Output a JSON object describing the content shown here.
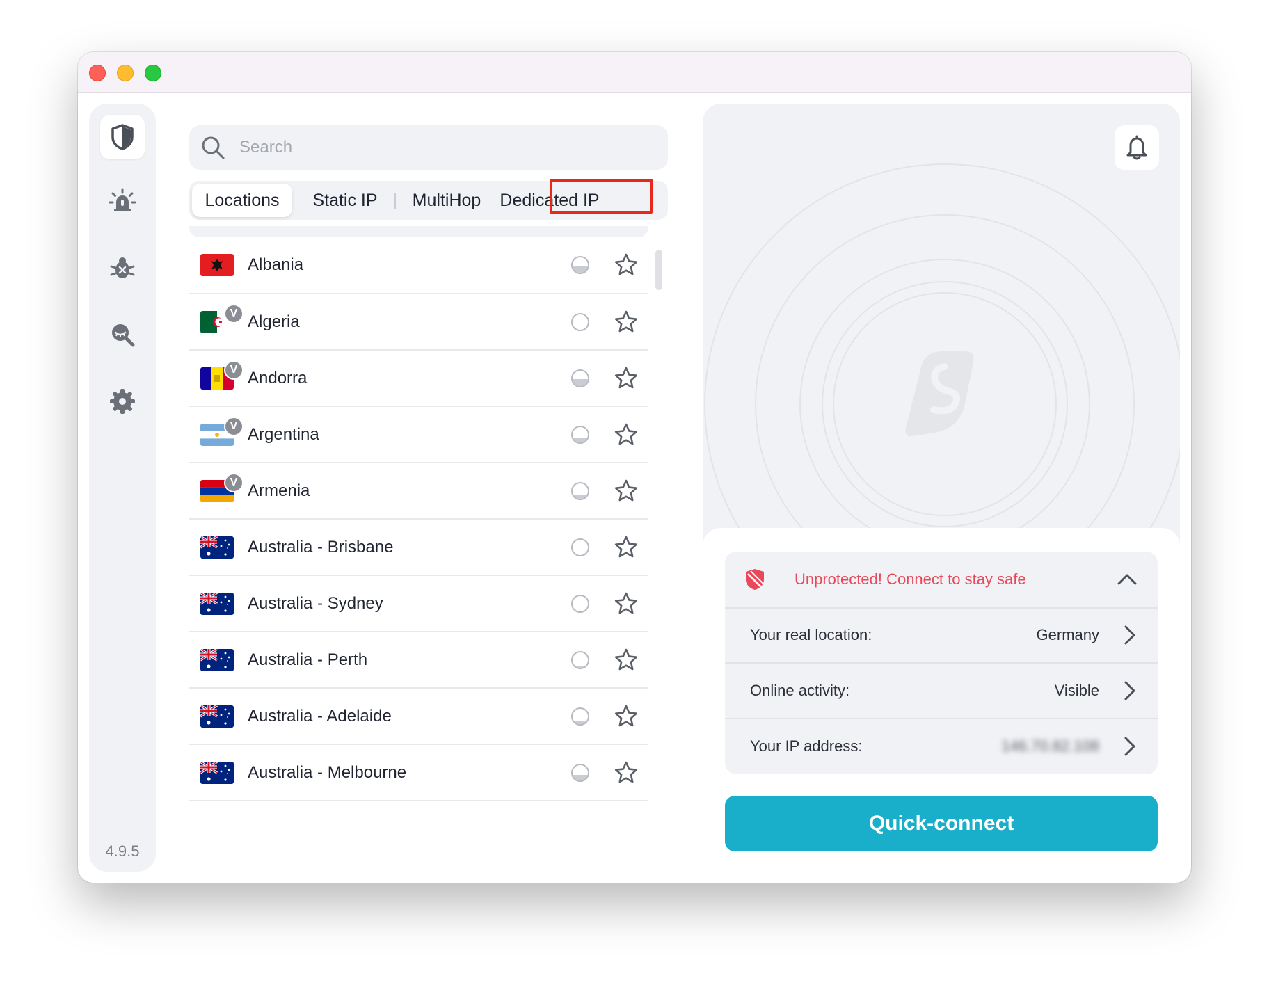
{
  "window": {
    "controls": [
      "close",
      "minimize",
      "zoom"
    ]
  },
  "sidebar": {
    "items": [
      {
        "name": "vpn",
        "icon": "shield-icon",
        "active": true
      },
      {
        "name": "alert",
        "icon": "alarm-light-icon",
        "active": false
      },
      {
        "name": "antivirus",
        "icon": "bug-blocked-icon",
        "active": false
      },
      {
        "name": "search-privacy",
        "icon": "eye-search-icon",
        "active": false
      },
      {
        "name": "settings",
        "icon": "gear-icon",
        "active": false
      }
    ],
    "version": "4.9.5"
  },
  "search": {
    "placeholder": "Search",
    "value": ""
  },
  "tabs": [
    {
      "label": "Locations",
      "active": true
    },
    {
      "label": "Static IP",
      "active": false
    },
    {
      "label": "MultiHop",
      "active": false
    },
    {
      "label": "Dedicated IP",
      "active": false,
      "highlighted": true
    }
  ],
  "highlight_color": "#e8281b",
  "locations": [
    {
      "name": "Albania",
      "flag": "AL",
      "virtual": false,
      "load": 0.45
    },
    {
      "name": "Algeria",
      "flag": "DZ",
      "virtual": true,
      "load": 0.0
    },
    {
      "name": "Andorra",
      "flag": "AD",
      "virtual": true,
      "load": 0.45
    },
    {
      "name": "Argentina",
      "flag": "AR",
      "virtual": true,
      "load": 0.25
    },
    {
      "name": "Armenia",
      "flag": "AM",
      "virtual": true,
      "load": 0.25
    },
    {
      "name": "Australia - Brisbane",
      "flag": "AU",
      "virtual": false,
      "load": 0.0
    },
    {
      "name": "Australia - Sydney",
      "flag": "AU",
      "virtual": false,
      "load": 0.0
    },
    {
      "name": "Australia - Perth",
      "flag": "AU",
      "virtual": false,
      "load": 0.1
    },
    {
      "name": "Australia - Adelaide",
      "flag": "AU",
      "virtual": false,
      "load": 0.2
    },
    {
      "name": "Australia - Melbourne",
      "flag": "AU",
      "virtual": false,
      "load": 0.35
    }
  ],
  "virtual_badge": "V",
  "status": {
    "message": "Unprotected! Connect to stay safe",
    "color": "#e8485a",
    "rows": [
      {
        "label": "Your real location:",
        "value": "Germany",
        "obscured": false
      },
      {
        "label": "Online activity:",
        "value": "Visible",
        "obscured": false
      },
      {
        "label": "Your IP address:",
        "value": "146.70.82.108",
        "obscured": true
      }
    ]
  },
  "quick_connect": {
    "label": "Quick-connect",
    "color": "#19aec9"
  }
}
